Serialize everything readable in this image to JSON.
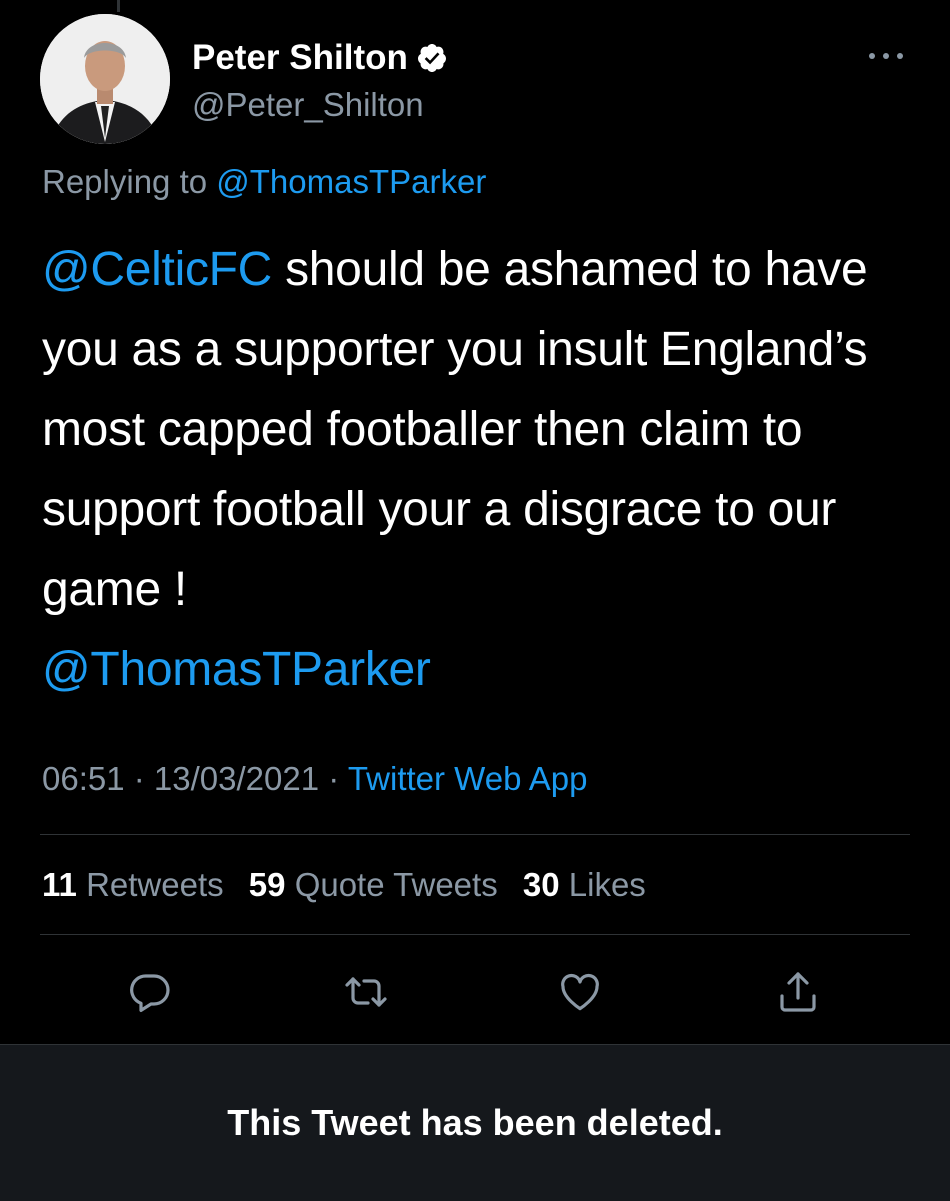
{
  "author": {
    "name": "Peter Shilton",
    "handle": "@Peter_Shilton"
  },
  "reply": {
    "prefix": "Replying to ",
    "mention": "@ThomasTParker"
  },
  "tweet": {
    "mention_start": "@CelticFC",
    "body": " should be ashamed to have you as a supporter you insult England’s most capped footballer then claim to support football your a disgrace to our game !",
    "mention_end": "@ThomasTParker"
  },
  "meta": {
    "time": "06:51",
    "sep1": " · ",
    "date": "13/03/2021",
    "sep2": " · ",
    "source": "Twitter Web App"
  },
  "stats": {
    "retweets_count": "11",
    "retweets_label": "Retweets",
    "quotes_count": "59",
    "quotes_label": "Quote Tweets",
    "likes_count": "30",
    "likes_label": "Likes"
  },
  "icons": {
    "reply": "reply-icon",
    "retweet": "retweet-icon",
    "like": "heart-icon",
    "share": "share-icon",
    "more": "more-icon",
    "verified": "verified-badge-icon"
  },
  "colors": {
    "background": "#000000",
    "link": "#1d9bf0",
    "muted": "#8b98a5",
    "divider": "#2f3336",
    "banner": "#15181c"
  },
  "banner": {
    "text": "This Tweet has been deleted."
  }
}
